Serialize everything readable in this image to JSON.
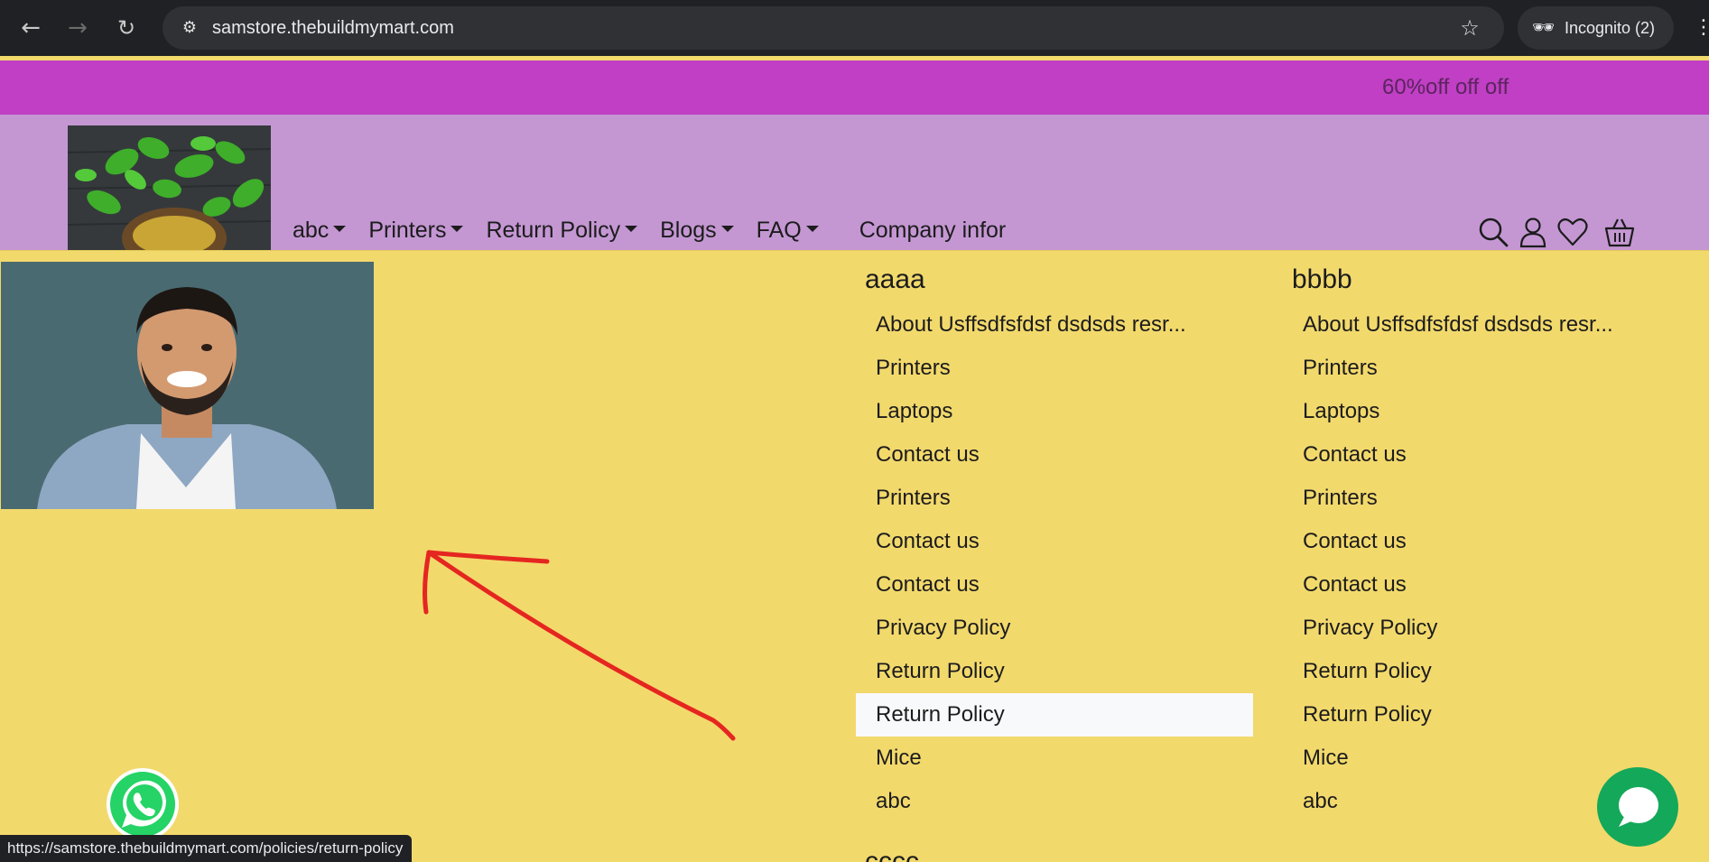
{
  "browser": {
    "url": "samstore.thebuildmymart.com",
    "profile_label": "Incognito (2)",
    "status_url": "https://samstore.thebuildmymart.com/policies/return-policy"
  },
  "promo": {
    "text": "60%off off off"
  },
  "nav": {
    "items": [
      {
        "label": "abc"
      },
      {
        "label": "Printers"
      },
      {
        "label": "Return Policy"
      },
      {
        "label": "Blogs"
      },
      {
        "label": "FAQ"
      }
    ],
    "plain_label": "Company infor"
  },
  "header_icons": [
    "search-icon",
    "user-icon",
    "heart-icon",
    "basket-icon"
  ],
  "mega_menu": {
    "columns": [
      {
        "title": "aaaa",
        "items": [
          "About Usffsdfsfdsf dsdsds resr...",
          "Printers",
          "Laptops",
          "Contact us",
          "Printers",
          "Contact us",
          "Contact us",
          "Privacy Policy",
          "Return Policy",
          "Return Policy",
          "Mice",
          "abc"
        ]
      },
      {
        "title": "bbbb",
        "items": [
          "About Usffsdfsfdsf dsdsds resr...",
          "Printers",
          "Laptops",
          "Contact us",
          "Printers",
          "Contact us",
          "Contact us",
          "Privacy Policy",
          "Return Policy",
          "Return Policy",
          "Mice",
          "abc"
        ]
      }
    ],
    "partial_title": "cccc",
    "active_item": {
      "column": 0,
      "index": 9
    }
  },
  "colors": {
    "promo_bg": "#c03fc4",
    "header_bg": "#c497d3",
    "mega_bg": "#f2d96c",
    "annotation_arrow": "#e52620",
    "chat_bg": "#14a85a"
  }
}
